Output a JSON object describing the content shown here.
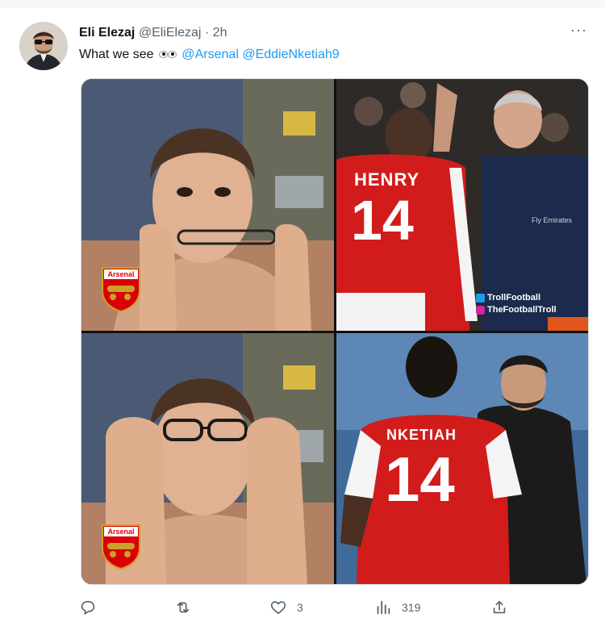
{
  "tweet": {
    "display_name": "Eli Elezaj",
    "handle": "@EliElezaj",
    "separator": "·",
    "time": "2h",
    "more_label": "···",
    "text_prefix": "What we see",
    "emoji": "eyes-emoji",
    "mentions": [
      "@Arsenal",
      "@EddieNketiah9"
    ]
  },
  "media": {
    "badge_text": "Arsenal",
    "henry_name": "HENRY",
    "henry_number": "14",
    "nketiah_name": "NKETIAH",
    "nketiah_number": "14",
    "kit_sponsor": "Fly Emirates",
    "watermark_twitter": "TrollFootball",
    "watermark_instagram": "TheFootballTroll"
  },
  "actions": {
    "reply_count": "",
    "retweet_count": "",
    "like_count": "3",
    "views_count": "319"
  },
  "colors": {
    "accent": "#1d9bf0",
    "muted": "#536471",
    "arsenal_red": "#db0007"
  }
}
